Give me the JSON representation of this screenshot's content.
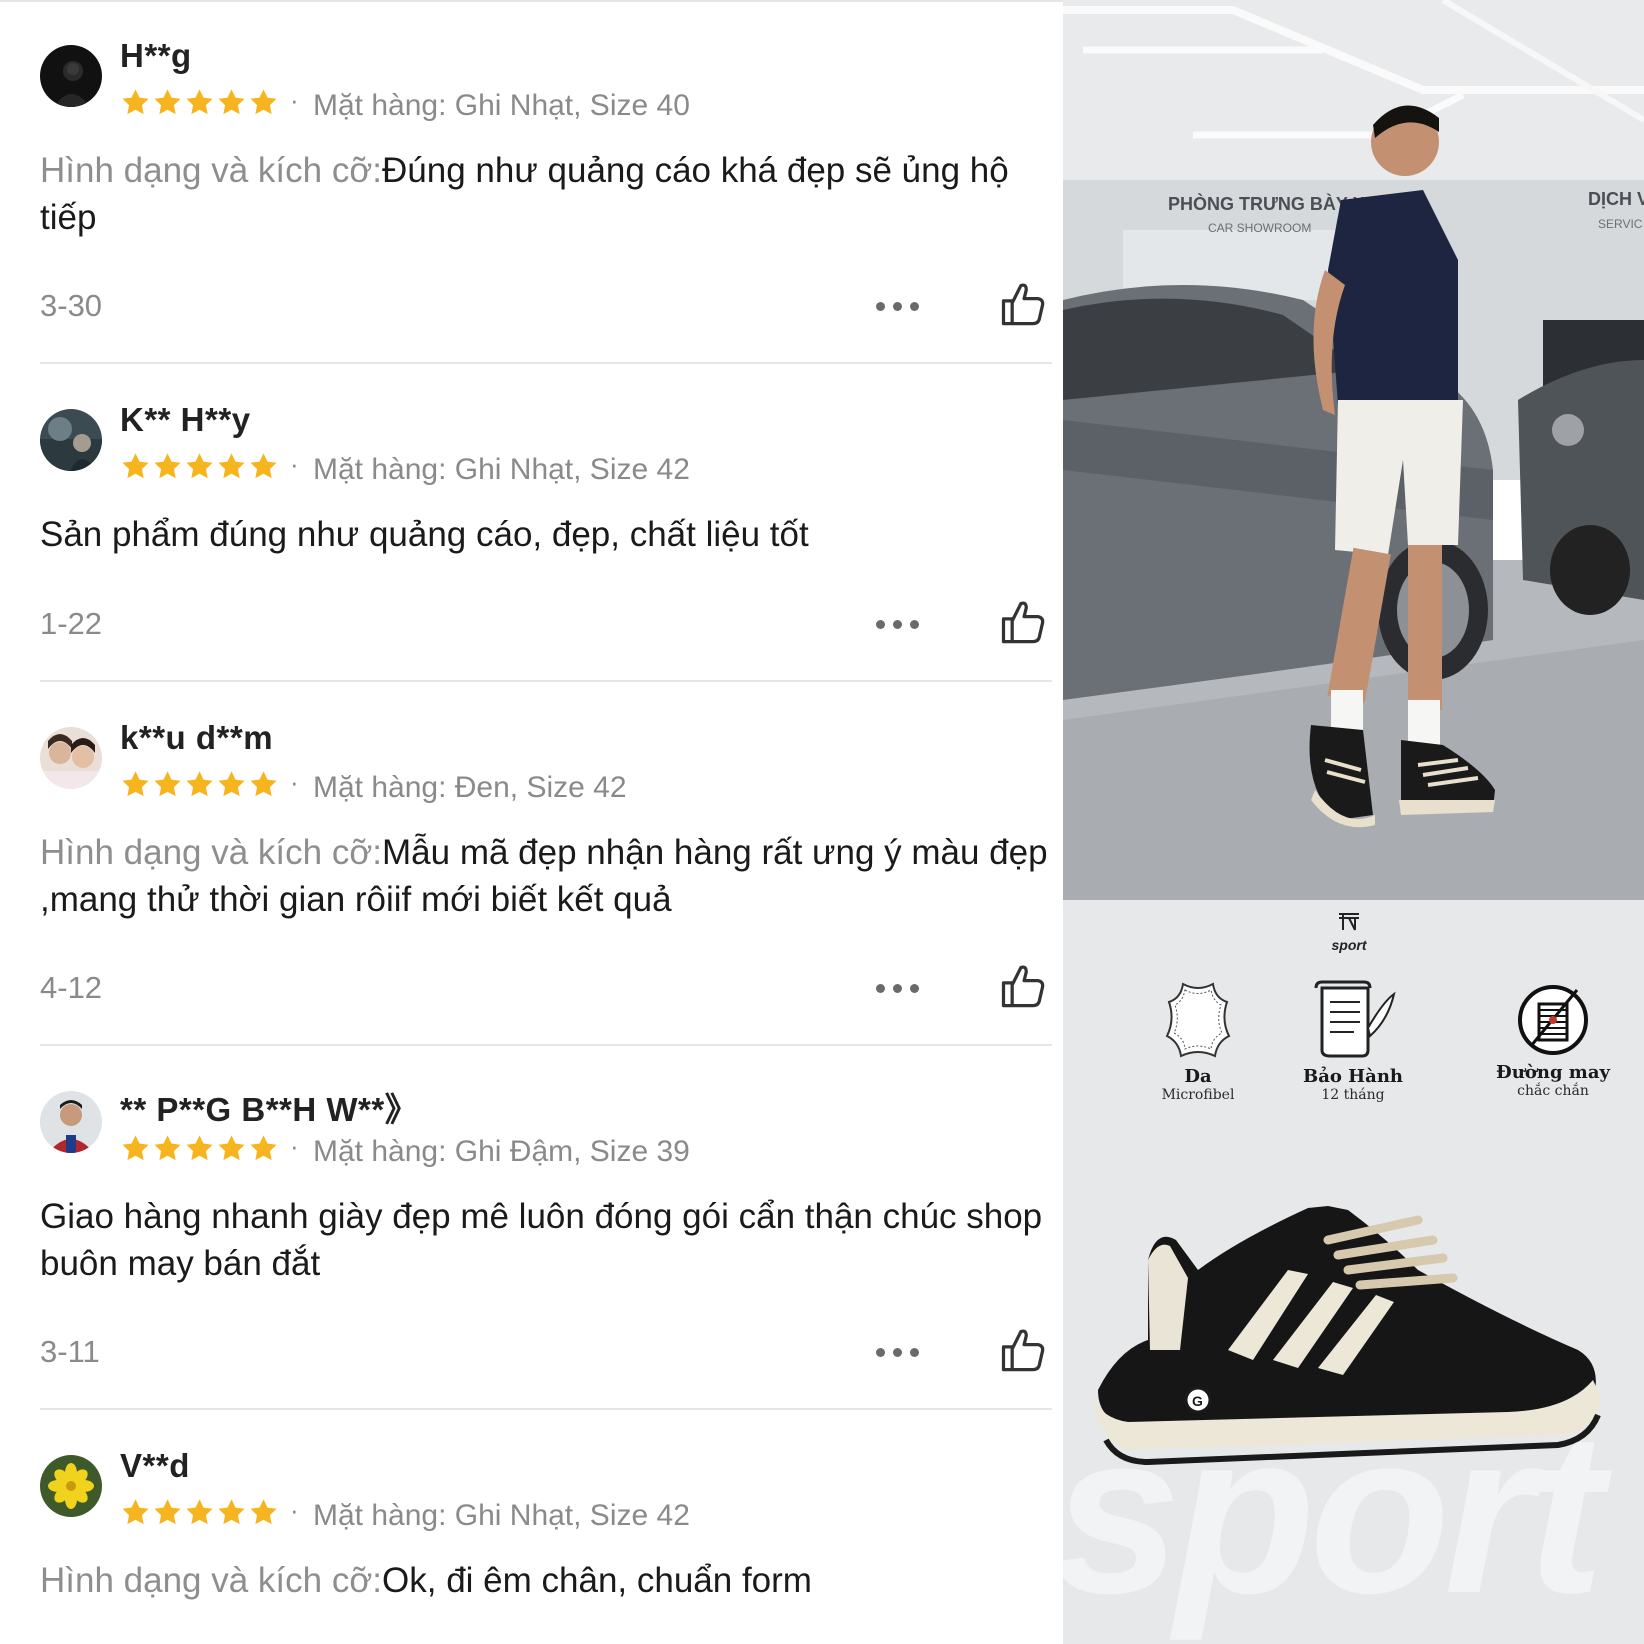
{
  "reviews": [
    {
      "username": "H**g",
      "rating": 5,
      "variant": "Mặt hàng: Ghi Nhạt, Size 40",
      "prefix": "Hình dạng và kích cỡ:",
      "text": "Đúng như quảng cáo khá đẹp sẽ ủng hộ tiếp",
      "date": "3-30"
    },
    {
      "username": "K** H**y",
      "rating": 5,
      "variant": "Mặt hàng: Ghi Nhạt, Size 42",
      "prefix": "",
      "text": "Sản phẩm đúng như quảng cáo, đẹp, chất liệu tốt",
      "date": "1-22"
    },
    {
      "username": "k**u d**m",
      "rating": 5,
      "variant": "Mặt hàng: Đen, Size 42",
      "prefix": "Hình dạng và kích cỡ:",
      "text": "Mẫu mã đẹp nhận hàng rất ưng ý màu đẹp ,mang thử thời gian rôiif mới biết kết quả",
      "date": "4-12"
    },
    {
      "username": "** P**G B**H W**》",
      "rating": 5,
      "variant": "Mặt hàng: Ghi Đậm, Size 39",
      "prefix": "",
      "text": "Giao hàng nhanh giày đẹp mê luôn đóng gói cẩn thận chúc shop buôn may bán đắt",
      "date": "3-11"
    },
    {
      "username": "V**d",
      "rating": 5,
      "variant": "Mặt hàng: Ghi Nhạt, Size 42",
      "prefix": "Hình dạng và kích cỡ:",
      "text": "Ok, đi êm chân, chuẩn form",
      "date": ""
    }
  ],
  "product": {
    "showroom_sign": "PHÒNG TRƯNG BÀY XE",
    "showroom_sub": "CAR SHOWROOM",
    "service_sign": "DỊCH V",
    "service_sub": "SERVIC",
    "brand": "sport",
    "features": [
      {
        "title": "Da",
        "subtitle": "Microfibel",
        "icon": "leather-icon"
      },
      {
        "title": "Bảo Hành",
        "subtitle": "12 tháng",
        "icon": "warranty-scroll-icon"
      },
      {
        "title": "Đường may",
        "subtitle": "chắc chắn",
        "icon": "thread-spool-icon"
      }
    ],
    "watermark": "sport"
  },
  "colors": {
    "star": "#f6b51e",
    "muted_text": "#8a8a8a",
    "separator": "#e6e6e6",
    "infocard_bg": "#e6e8ea"
  },
  "icons": {
    "more": "more-dots-icon",
    "like": "thumbs-up-icon"
  }
}
